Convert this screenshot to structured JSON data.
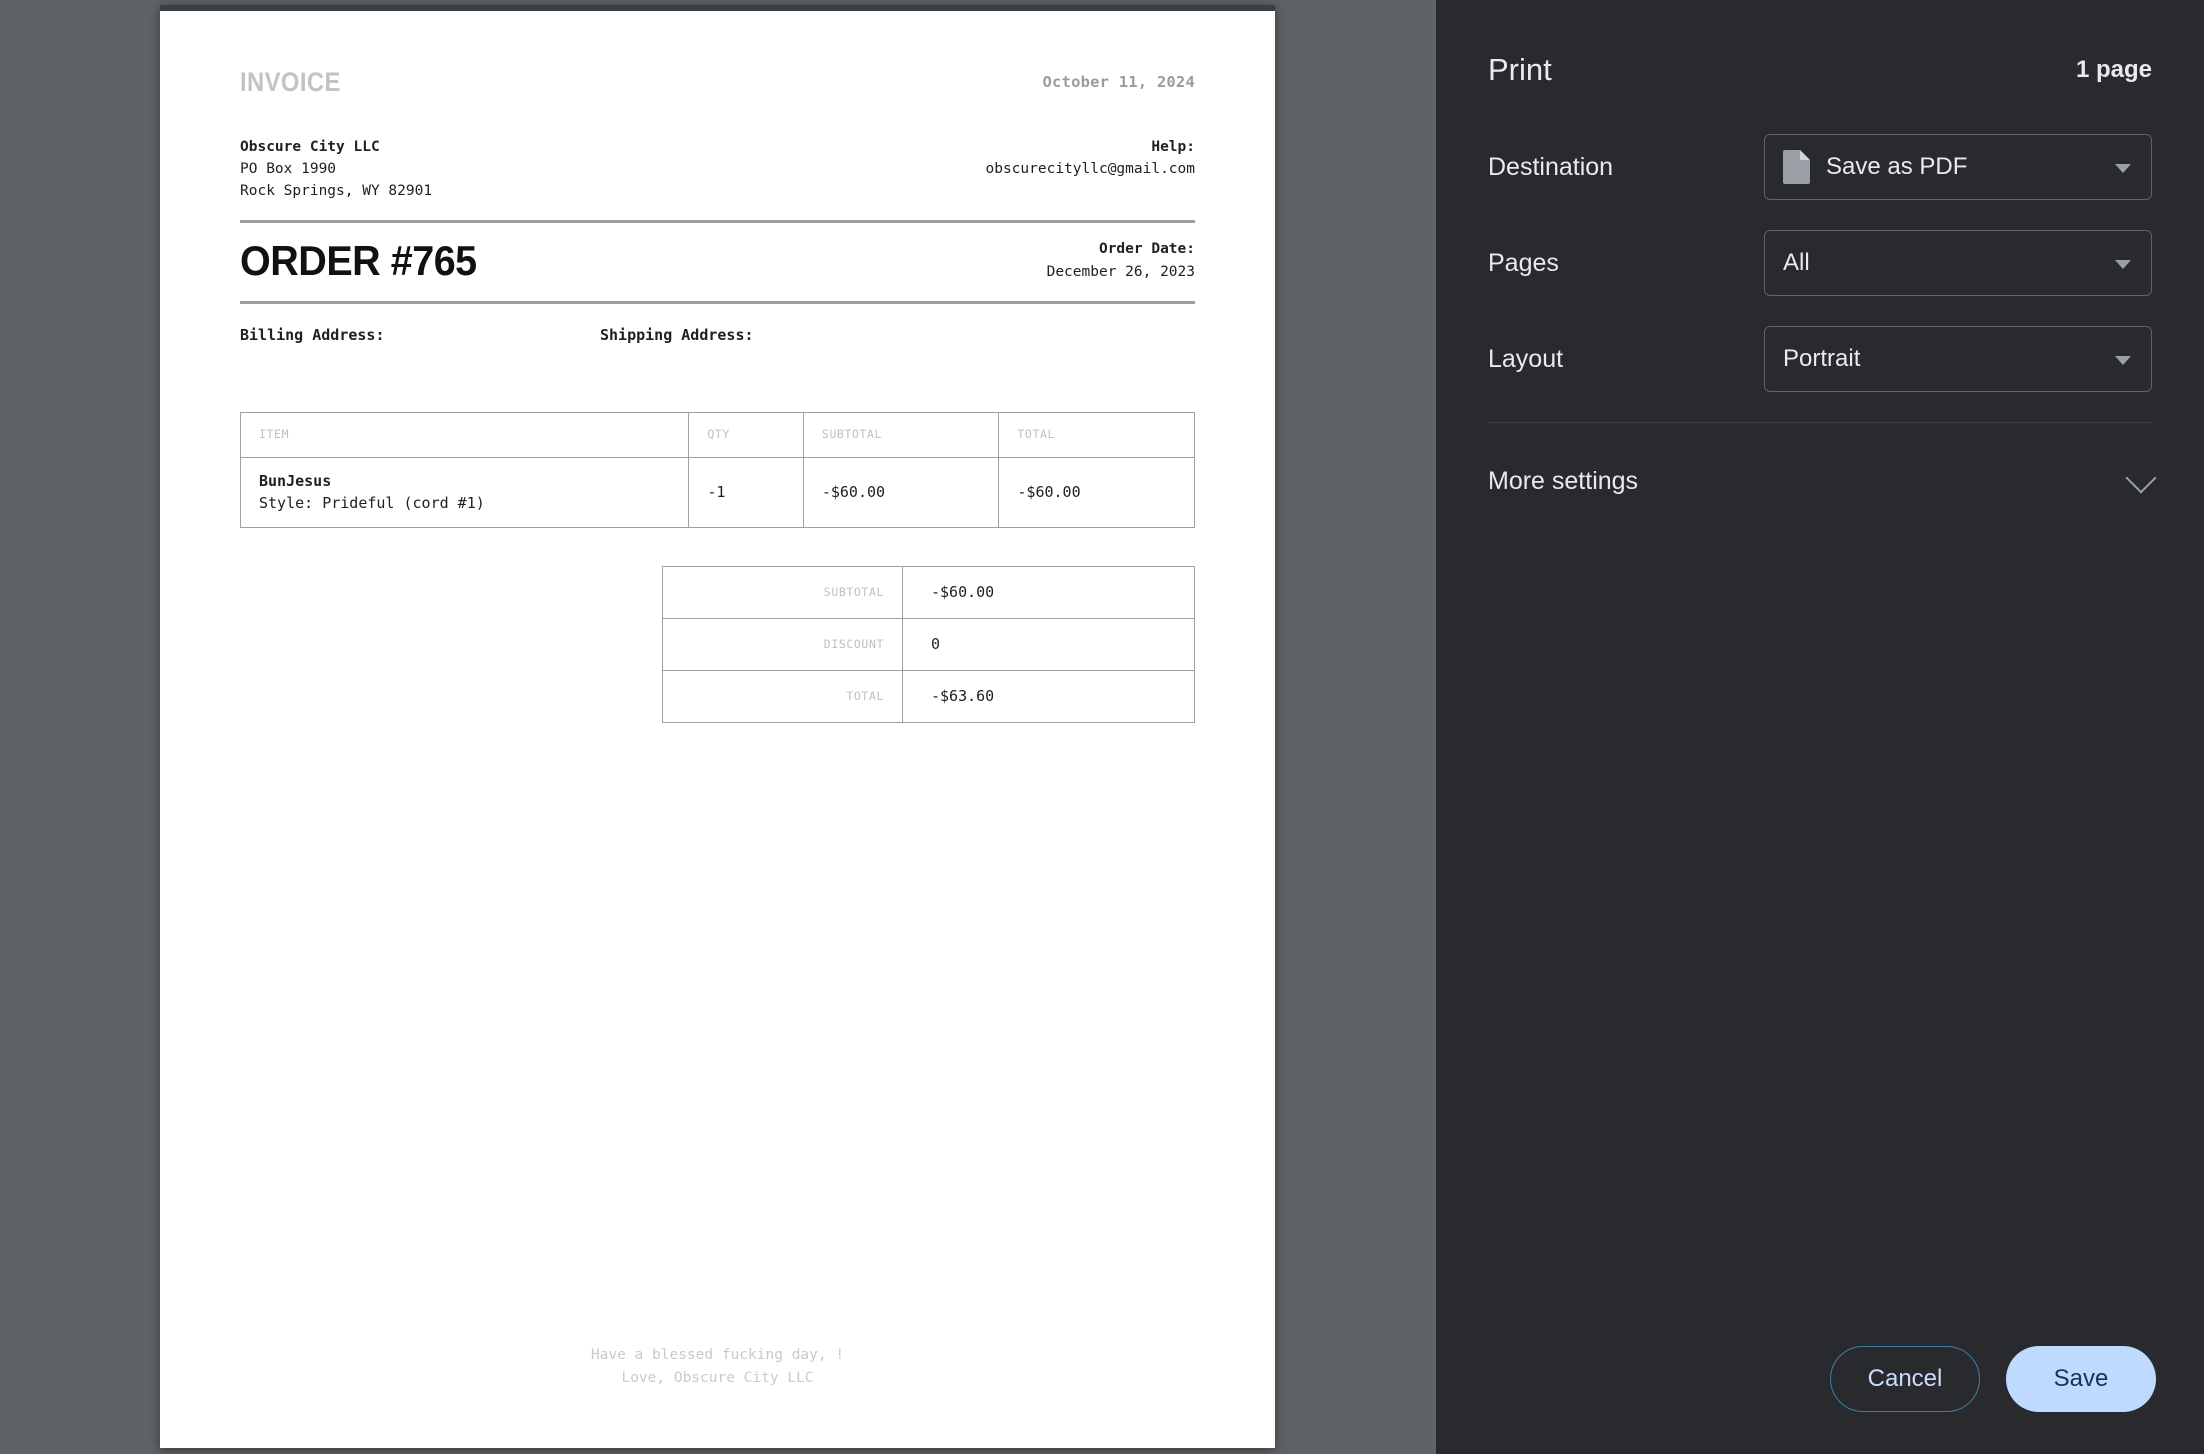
{
  "invoice": {
    "label": "INVOICE",
    "issue_date": "October 11, 2024",
    "business": {
      "name": "Obscure City LLC",
      "address_line1": "PO Box 1990",
      "address_line2": "Rock Springs, WY 82901"
    },
    "help": {
      "label": "Help:",
      "email": "obscurecityllc@gmail.com"
    },
    "order_number": "ORDER #765",
    "order_date_label": "Order Date:",
    "order_date": "December 26, 2023",
    "billing_address_label": "Billing Address:",
    "shipping_address_label": "Shipping Address:",
    "items_table": {
      "headers": [
        "ITEM",
        "QTY",
        "SUBTOTAL",
        "TOTAL"
      ],
      "rows": [
        {
          "item_name": "BunJesus",
          "item_style": "Style: Prideful (cord #1)",
          "qty": "-1",
          "subtotal": "-$60.00",
          "total": "-$60.00"
        }
      ]
    },
    "totals_table": {
      "rows": [
        {
          "label": "SUBTOTAL",
          "value": "-$60.00"
        },
        {
          "label": "DISCOUNT",
          "value": "0"
        },
        {
          "label": "TOTAL",
          "value": "-$63.60"
        }
      ]
    },
    "footer_line1": "Have a blessed fucking day, !",
    "footer_line2": "Love, Obscure City LLC"
  },
  "print_dialog": {
    "title": "Print",
    "page_count": "1 page",
    "destination": {
      "label": "Destination",
      "value": "Save as PDF",
      "icon": "pdf-document-icon"
    },
    "pages": {
      "label": "Pages",
      "value": "All"
    },
    "layout": {
      "label": "Layout",
      "value": "Portrait"
    },
    "more_settings": {
      "label": "More settings",
      "icon": "chevron-down-icon"
    },
    "cancel_label": "Cancel",
    "save_label": "Save",
    "colors": {
      "panel_bg": "#292a2d",
      "backdrop": "#5f6368",
      "save_bg": "#bedaff",
      "save_text": "#18325b",
      "cancel_border": "#3f7fa6",
      "cancel_text": "#c9dcff"
    }
  }
}
